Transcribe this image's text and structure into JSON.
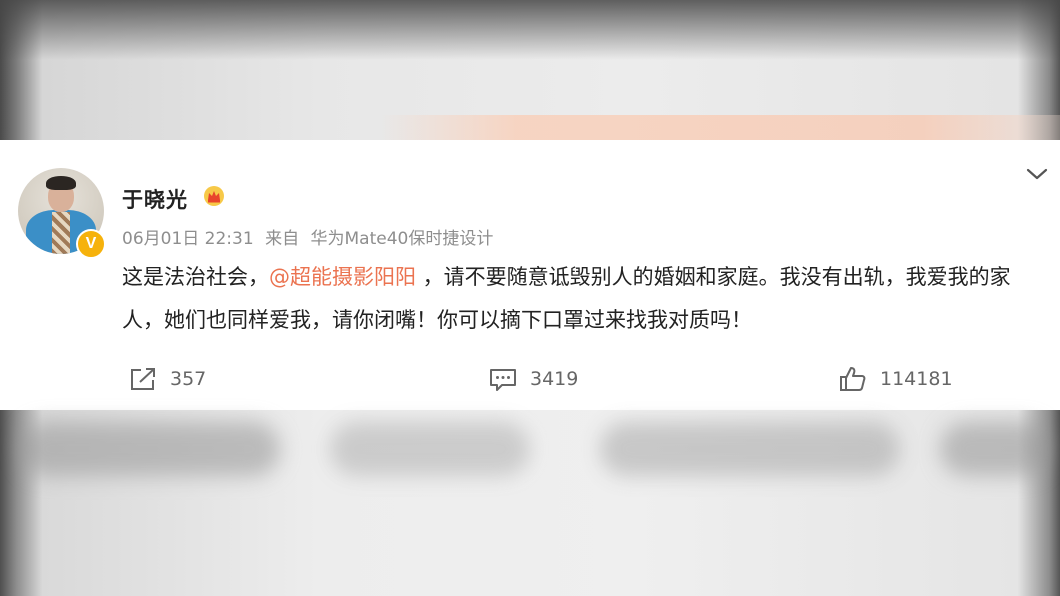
{
  "post": {
    "author": {
      "name": "于晓光",
      "verified_badge": "V",
      "badge_color": "#f6b20c",
      "crown_icon": "crown-icon"
    },
    "meta": {
      "date": "06月01日 22:31",
      "source_prefix": "来自",
      "source": "华为Mate40保时捷设计"
    },
    "text": {
      "part1": "这是法治社会，",
      "mention": "@超能摄影阳阳",
      "part2": " ，请不要随意诋毁别人的婚姻和家庭。我没有出轨，我爱我的家人，她们也同样爱我，请你闭嘴！你可以摘下口罩过来找我对质吗！"
    },
    "actions": {
      "repost_count": "357",
      "comment_count": "3419",
      "like_count": "114181"
    },
    "colors": {
      "mention": "#eb7350",
      "text": "#222222",
      "meta": "#8e8e8e"
    }
  }
}
